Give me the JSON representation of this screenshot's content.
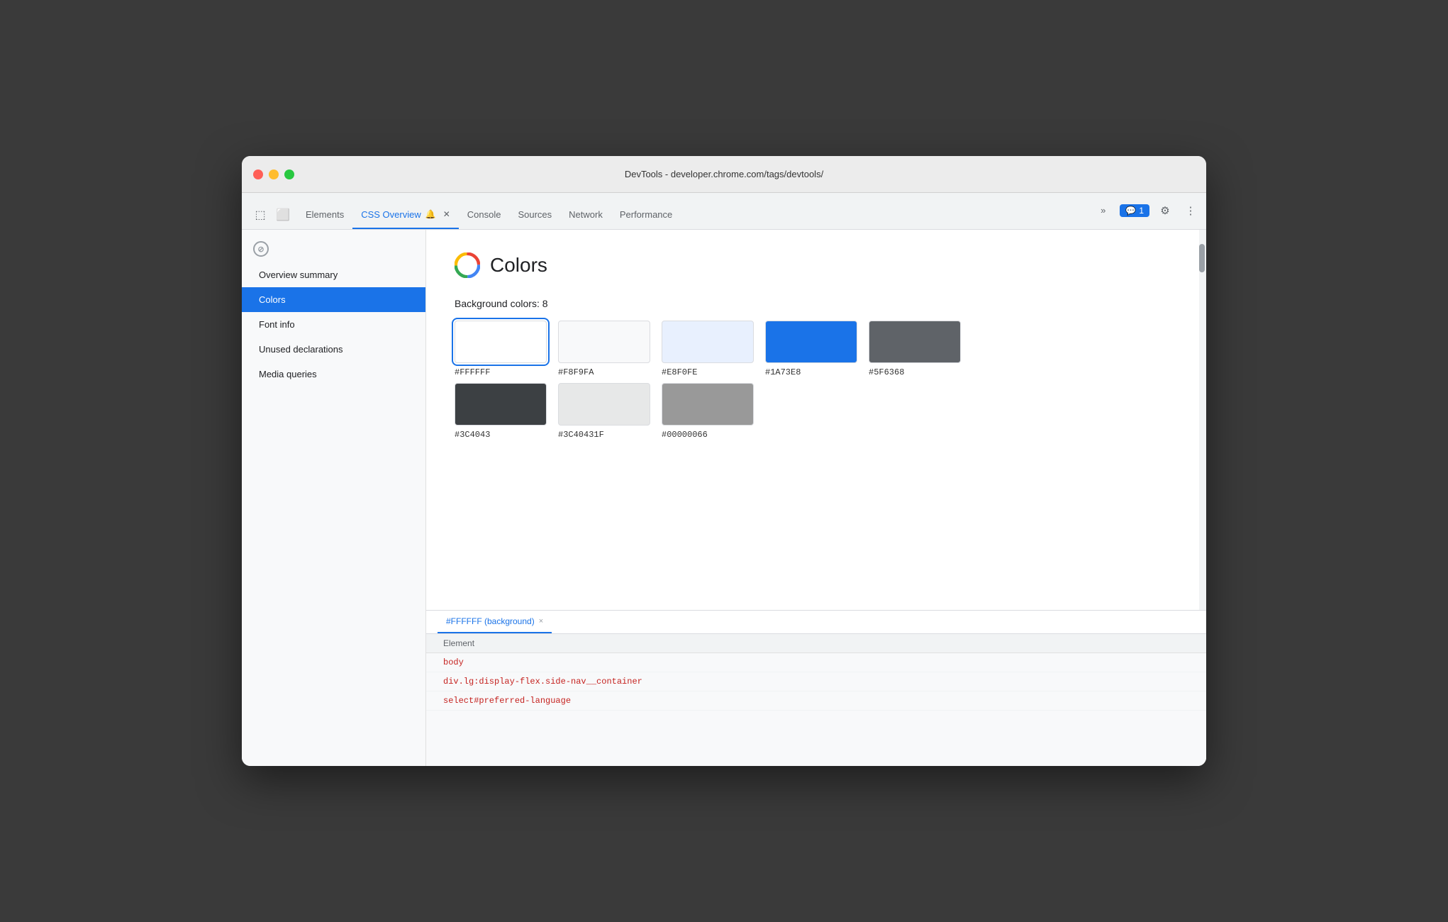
{
  "window": {
    "title": "DevTools - developer.chrome.com/tags/devtools/"
  },
  "tabs": [
    {
      "id": "elements",
      "label": "Elements",
      "active": false,
      "closable": false
    },
    {
      "id": "css-overview",
      "label": "CSS Overview",
      "active": true,
      "closable": true,
      "has_bell": true
    },
    {
      "id": "console",
      "label": "Console",
      "active": false,
      "closable": false
    },
    {
      "id": "sources",
      "label": "Sources",
      "active": false,
      "closable": false
    },
    {
      "id": "network",
      "label": "Network",
      "active": false,
      "closable": false
    },
    {
      "id": "performance",
      "label": "Performance",
      "active": false,
      "closable": false
    }
  ],
  "toolbar": {
    "more_label": "»",
    "chat_count": "1",
    "settings_icon": "⚙",
    "more_icon": "⋮"
  },
  "sidebar": {
    "items": [
      {
        "id": "overview-summary",
        "label": "Overview summary",
        "active": false
      },
      {
        "id": "colors",
        "label": "Colors",
        "active": true
      },
      {
        "id": "font-info",
        "label": "Font info",
        "active": false
      },
      {
        "id": "unused-declarations",
        "label": "Unused declarations",
        "active": false
      },
      {
        "id": "media-queries",
        "label": "Media queries",
        "active": false
      }
    ]
  },
  "main": {
    "page_icon": "google",
    "title": "Colors",
    "background_colors_label": "Background colors: 8",
    "colors": [
      {
        "id": "ffffff",
        "hex": "#FFFFFF",
        "value": "#FFFFFF",
        "style": "background:#FFFFFF; border:1px solid #dadce0;"
      },
      {
        "id": "f8f9fa",
        "hex": "#F8F9FA",
        "value": "#F8F9FA",
        "style": "background:#F8F9FA; border:1px solid #dadce0;"
      },
      {
        "id": "e8f0fe",
        "hex": "#E8F0FE",
        "value": "#E8F0FE",
        "style": "background:#E8F0FE; border:1px solid #dadce0;"
      },
      {
        "id": "1a73e8",
        "hex": "#1A73E8",
        "value": "#1A73E8",
        "style": "background:#1A73E8; border:1px solid #dadce0;"
      },
      {
        "id": "5f6368",
        "hex": "#5F6368",
        "value": "#5F6368",
        "style": "background:#5F6368; border:1px solid #dadce0;"
      },
      {
        "id": "3c4043",
        "hex": "#3C4043",
        "value": "#3C4043",
        "style": "background:#3C4043; border:1px solid #dadce0;"
      },
      {
        "id": "3c40431f",
        "hex": "#3C40431F",
        "value": "#3C40431F",
        "style": "background:rgba(60,64,67,0.12); border:1px solid #dadce0;"
      },
      {
        "id": "00000066",
        "hex": "#00000066",
        "value": "#00000066",
        "style": "background:rgba(0,0,0,0.4); border:1px solid #dadce0;"
      }
    ]
  },
  "bottom_panel": {
    "active_tab": "#FFFFFF (background)",
    "close_label": "×",
    "table_header": "Element",
    "rows": [
      {
        "value": "body"
      },
      {
        "value": "div.lg:display-flex.side-nav__container"
      },
      {
        "value": "select#preferred-language"
      }
    ]
  }
}
